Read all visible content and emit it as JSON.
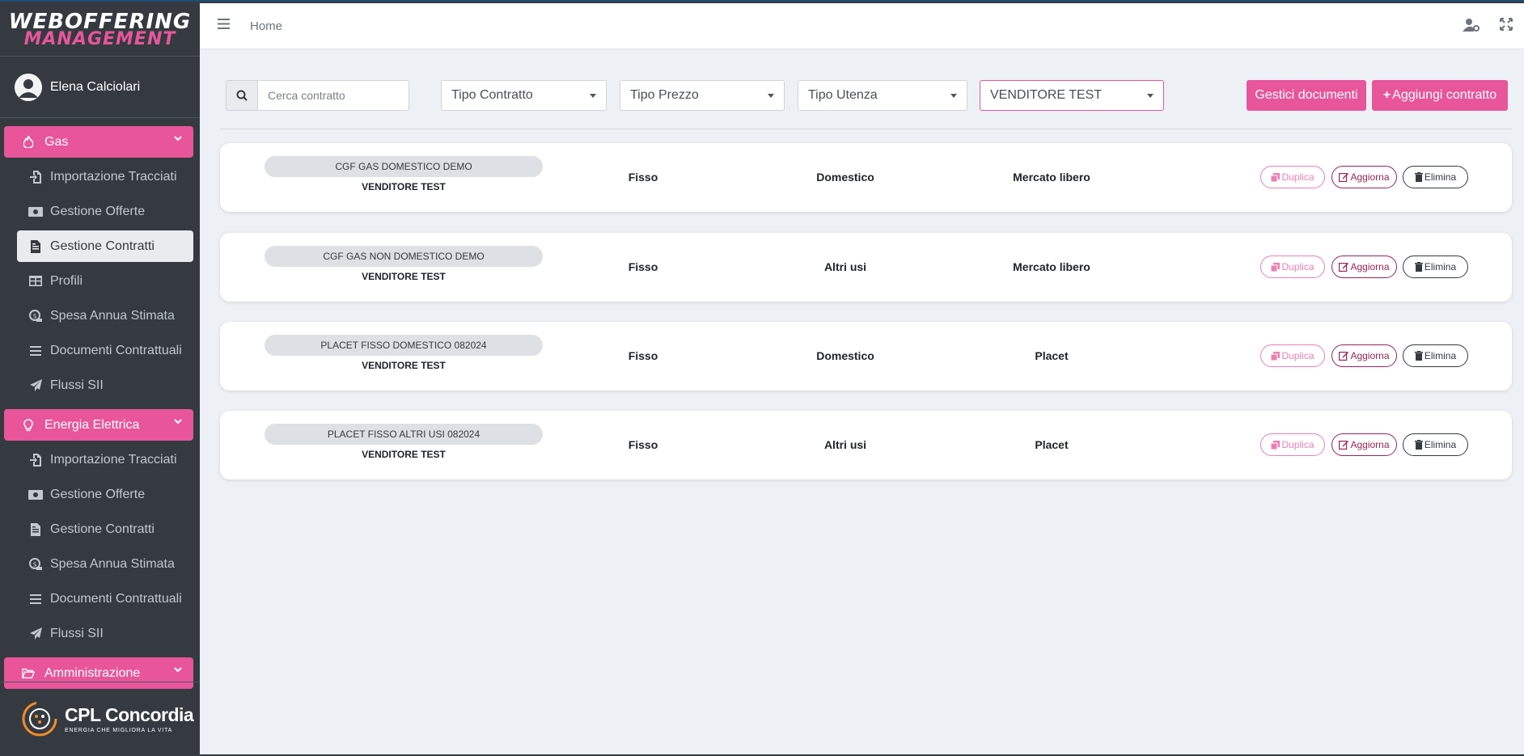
{
  "brand": {
    "line1": "WEBOFFERING",
    "line2": "MANAGEMENT"
  },
  "user": {
    "name": "Elena Calciolari"
  },
  "nav": {
    "gas": {
      "label": "Gas",
      "items": [
        {
          "label": "Importazione Tracciati",
          "icon": "file-import-icon"
        },
        {
          "label": "Gestione Offerte",
          "icon": "money-bill-icon"
        },
        {
          "label": "Gestione Contratti",
          "icon": "file-contract-icon",
          "active": true
        },
        {
          "label": "Profili",
          "icon": "table-icon"
        },
        {
          "label": "Spesa Annua Stimata",
          "icon": "coins-icon"
        },
        {
          "label": "Documenti Contrattuali",
          "icon": "list-icon"
        },
        {
          "label": "Flussi SII",
          "icon": "paper-plane-icon"
        }
      ]
    },
    "energia": {
      "label": "Energia Elettrica",
      "items": [
        {
          "label": "Importazione Tracciati",
          "icon": "file-import-icon"
        },
        {
          "label": "Gestione Offerte",
          "icon": "money-bill-icon"
        },
        {
          "label": "Gestione Contratti",
          "icon": "file-contract-icon"
        },
        {
          "label": "Spesa Annua Stimata",
          "icon": "coins-icon"
        },
        {
          "label": "Documenti Contrattuali",
          "icon": "list-icon"
        },
        {
          "label": "Flussi SII",
          "icon": "paper-plane-icon"
        }
      ]
    },
    "amministrazione": {
      "label": "Amministrazione"
    }
  },
  "footer": {
    "company": "CPL Concordia",
    "tagline": "ENERGIA CHE MIGLIORA LA VITA"
  },
  "topbar": {
    "breadcrumb": "Home"
  },
  "filters": {
    "search_placeholder": "Cerca contratto",
    "tipo_contratto": "Tipo Contratto",
    "tipo_prezzo": "Tipo Prezzo",
    "tipo_utenza": "Tipo Utenza",
    "venditore": "VENDITORE TEST",
    "gestisci_documenti": "Gestici documenti",
    "aggiungi_contratto": "Aggiungi contratto"
  },
  "actions": {
    "duplica": "Duplica",
    "aggiorna": "Aggiorna",
    "elimina": "Elimina"
  },
  "contracts": [
    {
      "name": "CGF GAS DOMESTICO DEMO",
      "vendor": "VENDITORE TEST",
      "prezzo": "Fisso",
      "utenza": "Domestico",
      "mercato": "Mercato libero"
    },
    {
      "name": "CGF GAS NON DOMESTICO DEMO",
      "vendor": "VENDITORE TEST",
      "prezzo": "Fisso",
      "utenza": "Altri usi",
      "mercato": "Mercato libero"
    },
    {
      "name": "PLACET FISSO DOMESTICO 082024",
      "vendor": "VENDITORE TEST",
      "prezzo": "Fisso",
      "utenza": "Domestico",
      "mercato": "Placet"
    },
    {
      "name": "PLACET FISSO ALTRI USI 082024",
      "vendor": "VENDITORE TEST",
      "prezzo": "Fisso",
      "utenza": "Altri usi",
      "mercato": "Placet"
    }
  ],
  "colors": {
    "accent": "#e8559a",
    "sidebar": "#343a40",
    "background": "#edf1f5"
  }
}
